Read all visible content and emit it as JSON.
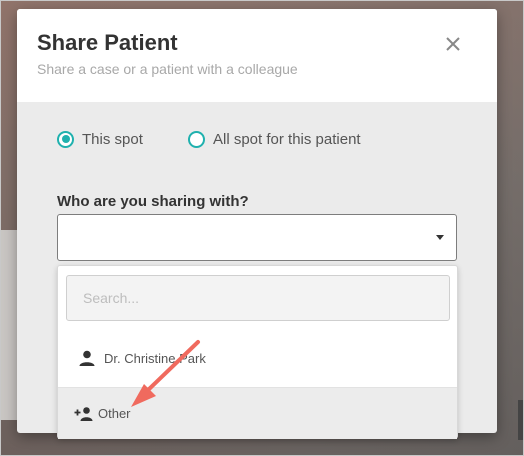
{
  "modal": {
    "title": "Share Patient",
    "subtitle": "Share a case or a patient with a colleague"
  },
  "scope": {
    "options": [
      {
        "label": "This spot",
        "checked": true
      },
      {
        "label": "All spot for this patient",
        "checked": false
      }
    ]
  },
  "recipient": {
    "label": "Who are you sharing with?",
    "value": "",
    "search_placeholder": "Search...",
    "options": [
      {
        "label": "Dr. Christine Park",
        "icon": "person-icon"
      },
      {
        "label": "Other",
        "icon": "person-add-icon"
      }
    ]
  },
  "colors": {
    "accent": "#1fb1ae",
    "annotation_arrow": "#f06a5e"
  }
}
